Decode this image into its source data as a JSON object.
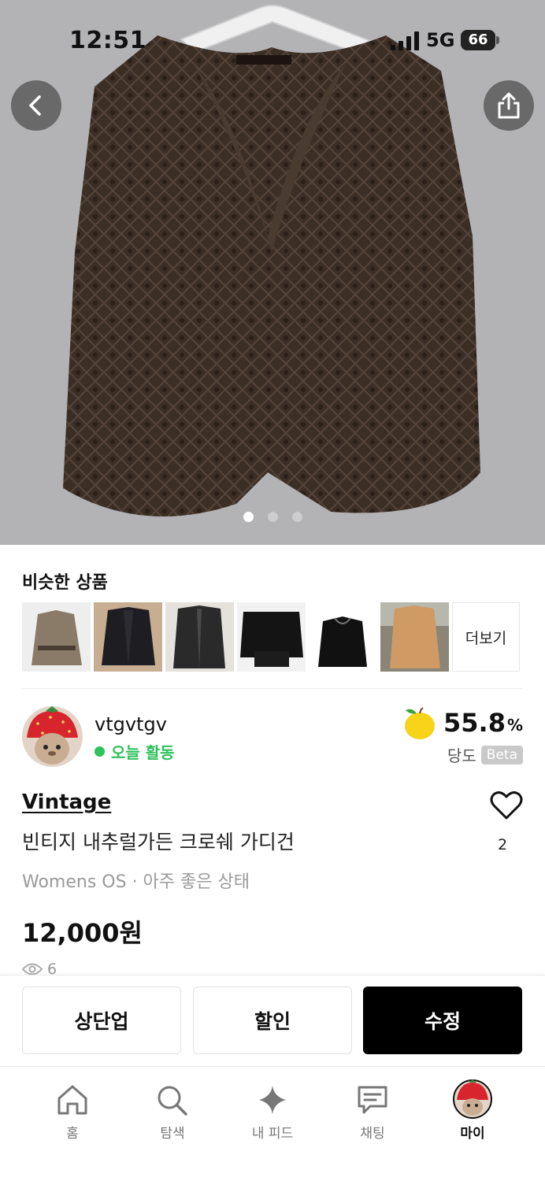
{
  "status_bar": {
    "time": "12:51",
    "network": "5G",
    "battery": "66"
  },
  "hero": {
    "image_icon": "cardigan-photo",
    "page_count": 3,
    "active_page": 1
  },
  "similar": {
    "title": "비슷한 상품",
    "items": [
      {
        "icon": "beige-cardigan-thumb"
      },
      {
        "icon": "sequin-cardigan-thumb"
      },
      {
        "icon": "black-knit-cardigan-thumb"
      },
      {
        "icon": "black-lace-top-thumb"
      },
      {
        "icon": "black-blouse-thumb"
      },
      {
        "icon": "orange-crochet-thumb"
      }
    ],
    "more_label": "더보기"
  },
  "seller": {
    "name": "vtgvtgv",
    "activity": "오늘 활동",
    "activity_color": "#2fc25b",
    "avatar_icon": "strawberry-hat-avatar",
    "dangdo_value": "55.8",
    "dangdo_unit": "%",
    "dangdo_label": "당도",
    "beta_label": "Beta"
  },
  "product": {
    "brand": "Vintage",
    "title": "빈티지 내추럴가든 크로쉐 가디건",
    "meta": "Womens OS · 아주 좋은 상태",
    "like_count": "2",
    "price": "12,000원",
    "views": "6"
  },
  "actions": {
    "bump": "상단업",
    "discount": "할인",
    "edit": "수정"
  },
  "tabs": [
    {
      "label": "홈",
      "icon": "home-icon"
    },
    {
      "label": "탐색",
      "icon": "search-icon"
    },
    {
      "label": "내 피드",
      "icon": "sparkle-icon"
    },
    {
      "label": "채팅",
      "icon": "chat-icon"
    },
    {
      "label": "마이",
      "icon": "profile-avatar-icon"
    }
  ],
  "colors": {
    "primary_button": "#000000",
    "active_green": "#2fc25b",
    "hero_bg": "#b3b3b5"
  }
}
